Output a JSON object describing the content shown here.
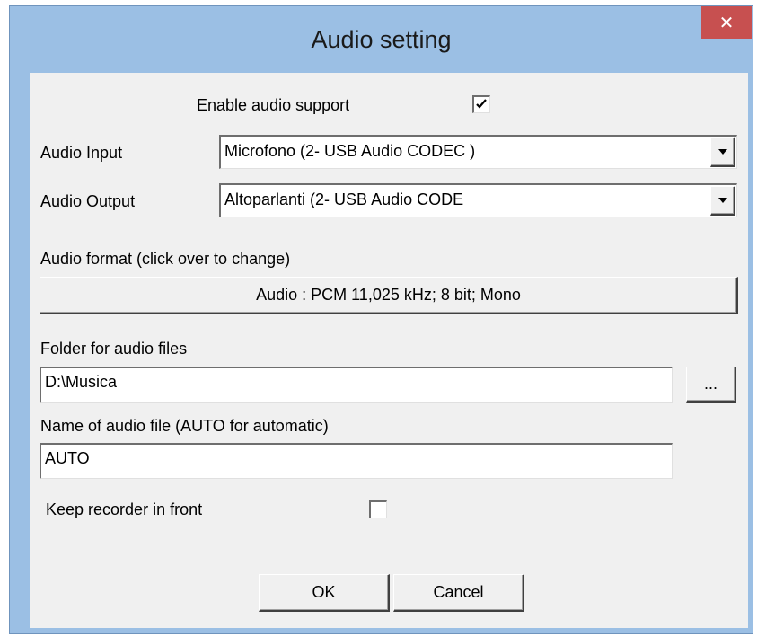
{
  "window": {
    "title": "Audio setting",
    "close_glyph": "✕"
  },
  "enable_audio": {
    "label": "Enable audio support",
    "checked": true
  },
  "audio_input": {
    "label": "Audio Input",
    "value": "Microfono (2- USB Audio CODEC )"
  },
  "audio_output": {
    "label": "Audio Output",
    "value": "Altoparlanti (2- USB Audio CODE"
  },
  "audio_format": {
    "label": "Audio format (click over to change)",
    "button_label": "Audio : PCM 11,025 kHz; 8 bit; Mono"
  },
  "folder": {
    "label": "Folder for audio files",
    "value": "D:\\Musica",
    "browse_label": "..."
  },
  "file_name": {
    "label": "Name of audio file (AUTO for automatic)",
    "value": "AUTO"
  },
  "keep_front": {
    "label": "Keep recorder in front",
    "checked": false
  },
  "buttons": {
    "ok": "OK",
    "cancel": "Cancel"
  },
  "colors": {
    "titlebar": "#9bbfe4",
    "close": "#c75050",
    "client": "#f0f0f0"
  },
  "icons": {
    "close": "close-icon",
    "dropdown": "dropdown-arrow-icon",
    "check": "checkmark-icon"
  }
}
